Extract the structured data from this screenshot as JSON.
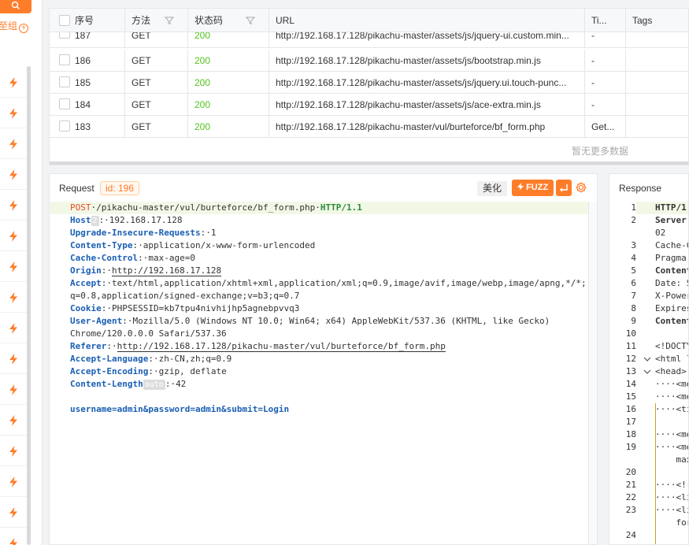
{
  "sidebar": {
    "search_icon_glyph": "🔍",
    "group_label": "至组",
    "plus_glyph": "+",
    "bolt_count": 16
  },
  "table": {
    "headers": {
      "seq": "序号",
      "method": "方法",
      "status": "状态码",
      "url": "URL",
      "title": "Ti...",
      "tags": "Tags"
    },
    "rows": [
      {
        "id": "187",
        "method": "GET",
        "status": "200",
        "url": "http://192.168.17.128/pikachu-master/assets/js/jquery-ui.custom.min...",
        "title": "-"
      },
      {
        "id": "186",
        "method": "GET",
        "status": "200",
        "url": "http://192.168.17.128/pikachu-master/assets/js/bootstrap.min.js",
        "title": "-"
      },
      {
        "id": "185",
        "method": "GET",
        "status": "200",
        "url": "http://192.168.17.128/pikachu-master/assets/js/jquery.ui.touch-punc...",
        "title": "-"
      },
      {
        "id": "184",
        "method": "GET",
        "status": "200",
        "url": "http://192.168.17.128/pikachu-master/assets/js/ace-extra.min.js",
        "title": "-"
      },
      {
        "id": "183",
        "method": "GET",
        "status": "200",
        "url": "http://192.168.17.128/pikachu-master/vul/burteforce/bf_form.php",
        "title": "Get..."
      }
    ],
    "no_more": "暂无更多数据"
  },
  "request": {
    "title": "Request",
    "id_badge": "id: 196",
    "beautify_label": "美化",
    "fuzz_label": "FUZZ",
    "lines": {
      "method": "POST",
      "path": "/pikachu-master/vul/burteforce/bf_form.php",
      "protocol": "HTTP/1.1",
      "host_key": "Host",
      "host_badge": "2",
      "host_val": "192.168.17.128",
      "uir_key": "Upgrade-Insecure-Requests",
      "uir_val": "1",
      "ct_key": "Content-Type",
      "ct_val": "application/x-www-form-urlencoded",
      "cc_key": "Cache-Control",
      "cc_val": "max-age=0",
      "origin_key": "Origin",
      "origin_val": "http://192.168.17.128",
      "accept_key": "Accept",
      "accept_val1": "text/html,application/xhtml+xml,application/xml;q=0.9,image/avif,image/webp,image/apng,*/*;",
      "accept_val2": "q=0.8,application/signed-exchange;v=b3;q=0.7",
      "cookie_key": "Cookie",
      "cookie_val": "PHPSESSID=kb7tpu4nivhijhp5agnebpvvq3",
      "ua_key": "User-Agent",
      "ua_val1": "Mozilla/5.0 (Windows NT 10.0; Win64; x64) AppleWebKit/537.36 (KHTML, like Gecko)",
      "ua_val2": "Chrome/120.0.0.0 Safari/537.36",
      "referer_key": "Referer",
      "referer_val": "http://192.168.17.128/pikachu-master/vul/burteforce/bf_form.php",
      "al_key": "Accept-Language",
      "al_val": "zh-CN,zh;q=0.9",
      "ae_key": "Accept-Encoding",
      "ae_val": "gzip, deflate",
      "cl_key": "Content-Length",
      "cl_badge": "auto",
      "cl_val": "42",
      "body": "username=admin&password=admin&submit=Login"
    }
  },
  "response": {
    "title": "Response",
    "line_numbers": [
      "1",
      "2",
      "",
      "3",
      "4",
      "5",
      "6",
      "7",
      "8",
      "9",
      "10",
      "11",
      "12",
      "13",
      "14",
      "15",
      "16",
      "17",
      "18",
      "19",
      "",
      "20",
      "21",
      "22",
      "23",
      "",
      "24"
    ],
    "lines": [
      {
        "text": "HTTP/1.",
        "cls": "kw-blue"
      },
      {
        "text": "Server:",
        "cls": "kw-blue"
      },
      {
        "text": "02",
        "cls": "val"
      },
      {
        "text": "Cache-C",
        "cls": "val"
      },
      {
        "text": "Pragma:",
        "cls": "val"
      },
      {
        "text": "Content",
        "cls": "kw-blue"
      },
      {
        "text": "Date: S",
        "cls": "val"
      },
      {
        "text": "X-Power",
        "cls": "val"
      },
      {
        "text": "Expires",
        "cls": "val"
      },
      {
        "text": "Content",
        "cls": "kw-blue"
      },
      {
        "text": "",
        "cls": "val"
      },
      {
        "text": "<!DOCTY",
        "cls": "val"
      },
      {
        "text": "<html l",
        "cls": "val"
      },
      {
        "text": "<head>",
        "cls": "val"
      },
      {
        "text": "····<me",
        "cls": "val"
      },
      {
        "text": "····<me",
        "cls": "val"
      },
      {
        "text": "····<ti",
        "cls": "val"
      },
      {
        "text": "",
        "cls": "val"
      },
      {
        "text": "····<me",
        "cls": "val"
      },
      {
        "text": "····<me",
        "cls": "val"
      },
      {
        "text": "    max",
        "cls": "val"
      },
      {
        "text": "",
        "cls": "val"
      },
      {
        "text": "····<!-",
        "cls": "val"
      },
      {
        "text": "····<li",
        "cls": "val"
      },
      {
        "text": "····<li",
        "cls": "val"
      },
      {
        "text": "    for",
        "cls": "val"
      },
      {
        "text": "",
        "cls": "val"
      }
    ]
  },
  "colors": {
    "accent": "#ff7d29",
    "status_ok": "#52c41a",
    "keyword_blue": "#1a5fb4",
    "method_red": "#e34c26"
  }
}
